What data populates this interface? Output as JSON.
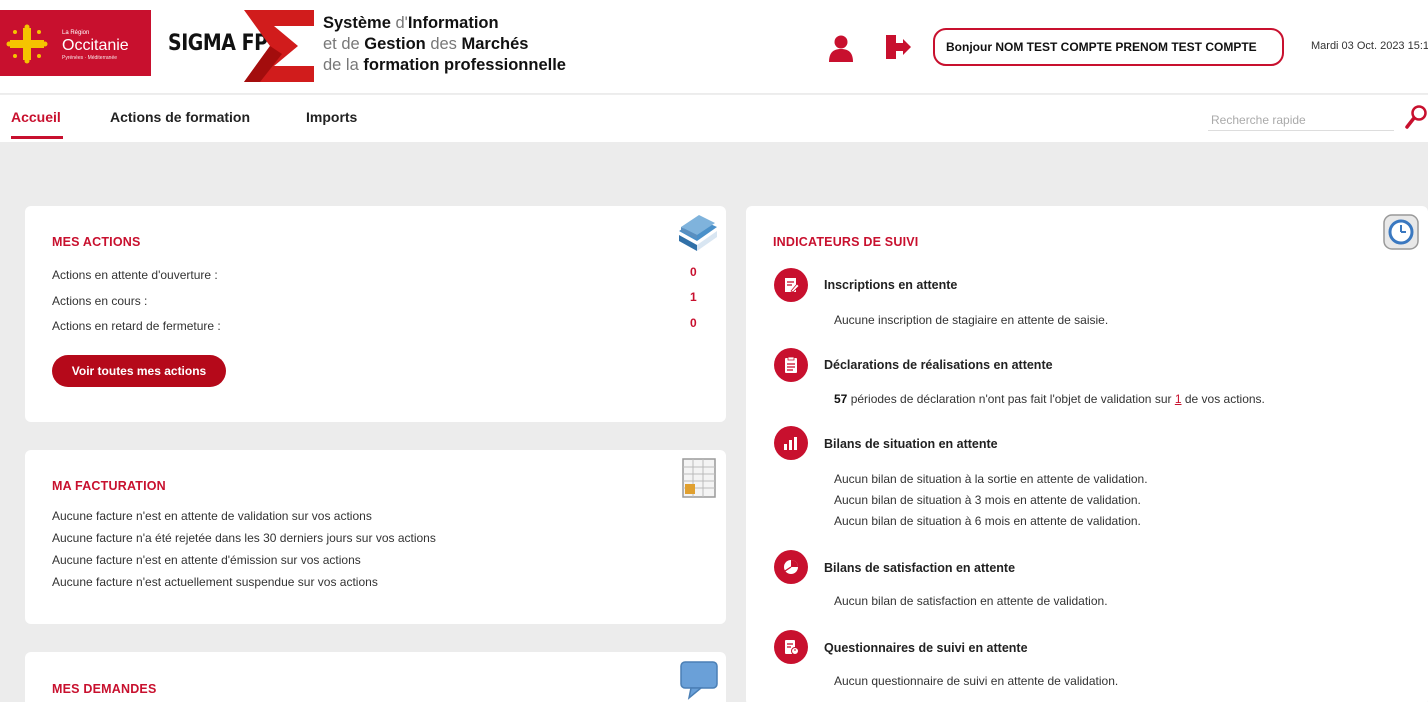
{
  "header": {
    "region_small": "La Région",
    "region_name": "Occitanie",
    "region_sub": "Pyrénées · Méditerranée",
    "app_name": "SIGMA FP",
    "title_line1_a": "Système",
    "title_line1_b": " d'",
    "title_line1_c": "Information",
    "title_line2_a": "et de ",
    "title_line2_b": "Gestion",
    "title_line2_c": " des ",
    "title_line2_d": "Marchés",
    "title_line3_a": "de la ",
    "title_line3_b": "formation professionnelle",
    "greeting": "Bonjour NOM TEST COMPTE PRENOM TEST COMPTE",
    "date": "Mardi 03 Oct. 2023 15:1"
  },
  "nav": {
    "tabs": [
      {
        "label": "Accueil"
      },
      {
        "label": "Actions de formation"
      },
      {
        "label": "Imports"
      }
    ],
    "search_placeholder": "Recherche rapide"
  },
  "mes_actions": {
    "title": "MES ACTIONS",
    "rows": [
      {
        "label": "Actions en attente d'ouverture :",
        "value": "0"
      },
      {
        "label": "Actions en cours :",
        "value": "1"
      },
      {
        "label": "Actions en retard de fermeture :",
        "value": "0"
      }
    ],
    "button": "Voir toutes mes actions"
  },
  "ma_facturation": {
    "title": "MA FACTURATION",
    "lines": [
      "Aucune facture n'est en attente de validation sur vos actions",
      "Aucune facture n'a été rejetée dans les 30 derniers jours sur vos actions",
      "Aucune facture n'est en attente d'émission sur vos actions",
      "Aucune facture n'est actuellement suspendue sur vos actions"
    ]
  },
  "mes_demandes": {
    "title": "MES DEMANDES"
  },
  "indicateurs": {
    "title": "INDICATEURS DE SUIVI",
    "inscriptions": {
      "title": "Inscriptions en attente",
      "text": "Aucune inscription de stagiaire en attente de saisie."
    },
    "declarations": {
      "title": "Déclarations de réalisations en attente",
      "count": "57",
      "text_a": " périodes de déclaration n'ont pas fait l'objet de validation sur ",
      "link": "1",
      "text_b": " de vos actions."
    },
    "bilans_situation": {
      "title": "Bilans de situation en attente",
      "lines": [
        "Aucun bilan de situation à la sortie en attente de validation.",
        "Aucun bilan de situation à 3 mois en attente de validation.",
        "Aucun bilan de situation à 6 mois en attente de validation."
      ]
    },
    "bilans_satisfaction": {
      "title": "Bilans de satisfaction en attente",
      "text": "Aucun bilan de satisfaction en attente de validation."
    },
    "questionnaires": {
      "title": "Questionnaires de suivi en attente",
      "text": "Aucun questionnaire de suivi en attente de validation."
    }
  },
  "colors": {
    "brand_red": "#c8102e",
    "button_red": "#b5091a",
    "page_bg": "#ececec"
  }
}
